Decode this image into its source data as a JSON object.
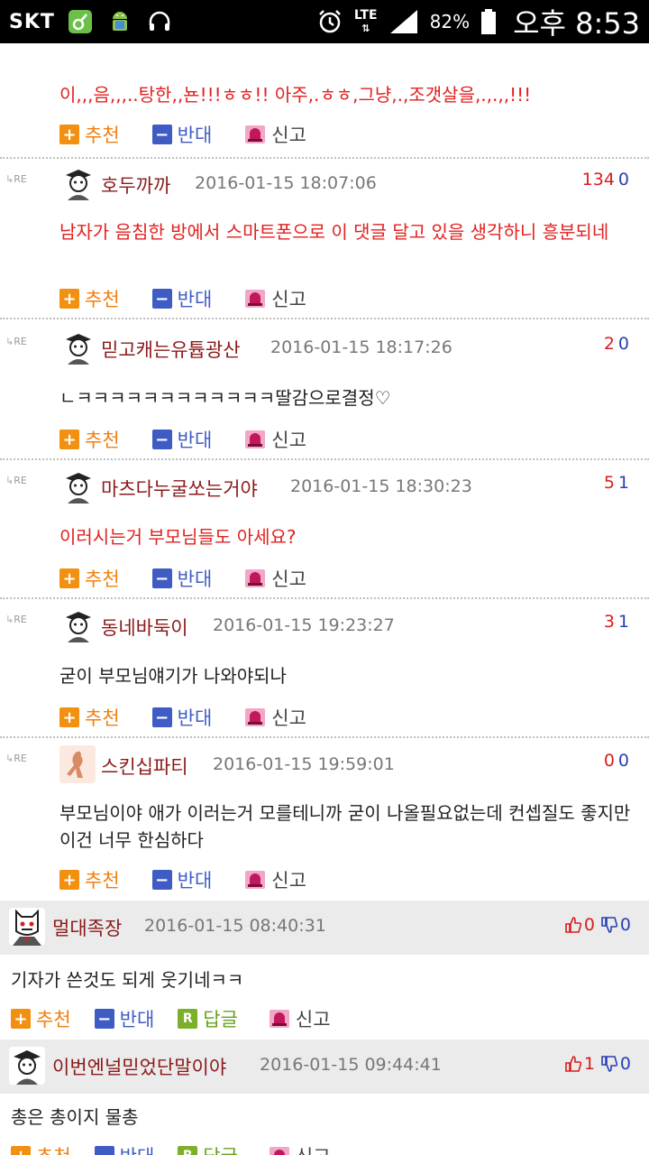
{
  "status_bar": {
    "carrier": "SKT",
    "network": "LTE",
    "battery": "82%",
    "time": "오후 8:53",
    "icons": [
      "phone-app-icon",
      "android-icon",
      "headset-icon",
      "alarm-icon",
      "signal-icon",
      "battery-icon"
    ]
  },
  "actions": {
    "recommend": "추천",
    "oppose": "반대",
    "reply": "답글",
    "report": "신고"
  },
  "re_label": "RE",
  "partial_top": {
    "text": "이,,,음,,,..탕한,,뇬!!!ㅎㅎ!! 아주,.ㅎㅎ,그냥,.,조갯살을,.,.,,!!!"
  },
  "replies": [
    {
      "nickname": "호두까까",
      "date": "2016-01-15 18:07:06",
      "up": "134",
      "down": "0",
      "text": "남자가 음침한 방에서 스마트폰으로 이 댓글 달고 있을 생각하니 흥분되네",
      "red": true
    },
    {
      "nickname": "믿고캐는유튭광산",
      "date": "2016-01-15 18:17:26",
      "up": "2",
      "down": "0",
      "text": "ㄴㅋㅋㅋㅋㅋㅋㅋㅋㅋㅋㅋㅋ딸감으로결정♡",
      "red": false
    },
    {
      "nickname": "마츠다누굴쏘는거야",
      "date": "2016-01-15 18:30:23",
      "up": "5",
      "down": "1",
      "text": "이러시는거 부모님들도 아세요?",
      "red": true
    },
    {
      "nickname": "동네바둑이",
      "date": "2016-01-15 19:23:27",
      "up": "3",
      "down": "1",
      "text": "굳이 부모님얘기가 나와야되나",
      "red": false
    },
    {
      "nickname": "스킨십파티",
      "date": "2016-01-15 19:59:01",
      "up": "0",
      "down": "0",
      "text": "부모님이야 애가 이러는거 모를테니까 굳이 나올필요없는데 컨셉질도 좋지만 이건 너무 한심하다",
      "red": false
    }
  ],
  "top_comments": [
    {
      "nickname": "멀대족장",
      "date": "2016-01-15 08:40:31",
      "up": "0",
      "down": "0",
      "text": "기자가 쓴것도 되게 웃기네ㅋㅋ"
    },
    {
      "nickname": "이번엔널믿었단말이야",
      "date": "2016-01-15 09:44:41",
      "up": "1",
      "down": "0",
      "text": "총은 총이지 물총"
    }
  ]
}
